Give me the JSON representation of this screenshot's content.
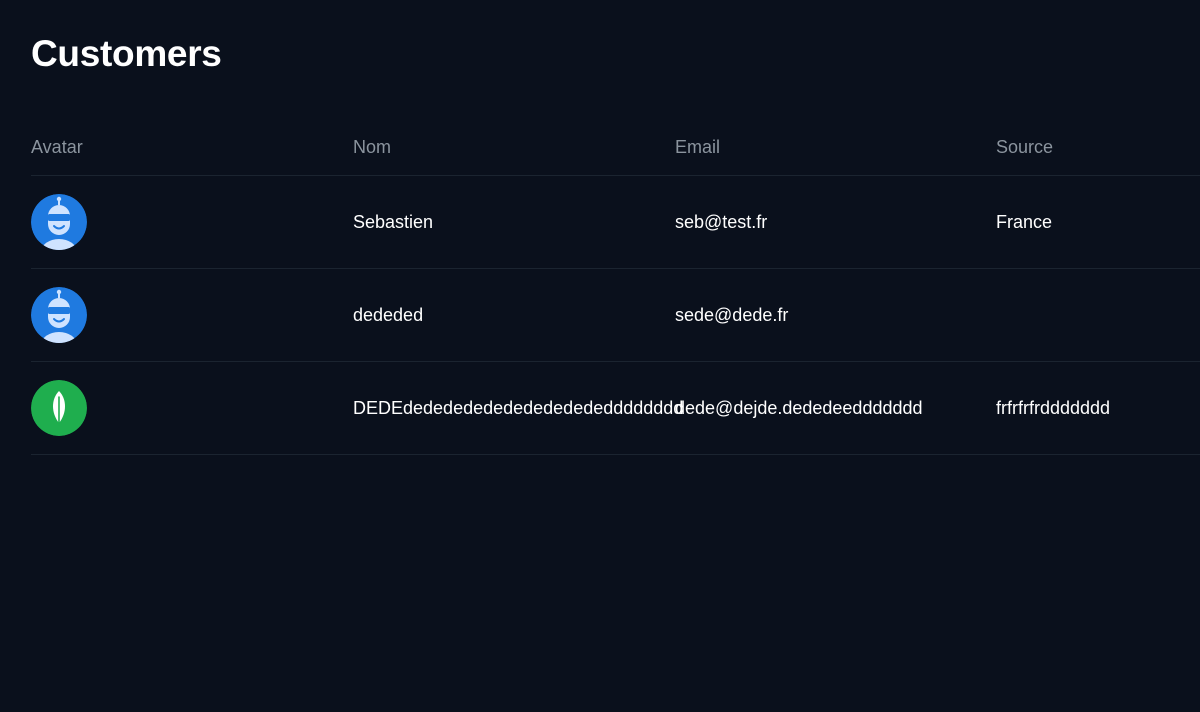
{
  "page": {
    "title": "Customers"
  },
  "table": {
    "columns": {
      "avatar": "Avatar",
      "name": "Nom",
      "email": "Email",
      "source": "Source"
    },
    "rows": [
      {
        "avatar_icon": "robot-avatar-icon",
        "avatar_color": "#1f7ae0",
        "name": "Sebastien",
        "email": "seb@test.fr",
        "source": "France"
      },
      {
        "avatar_icon": "robot-avatar-icon",
        "avatar_color": "#1f7ae0",
        "name": "dededed",
        "email": "sede@dede.fr",
        "source": ""
      },
      {
        "avatar_icon": "leaf-avatar-icon",
        "avatar_color": "#1fae4e",
        "name": "DEDEdededededededededededddddddd",
        "email": "dede@dejde.dededeeddddddd",
        "source": "frfrfrfrddddddd"
      }
    ]
  },
  "colors": {
    "background": "#0a101c",
    "divider": "#1b2430",
    "header_text": "#8b949e",
    "body_text": "#ffffff"
  }
}
